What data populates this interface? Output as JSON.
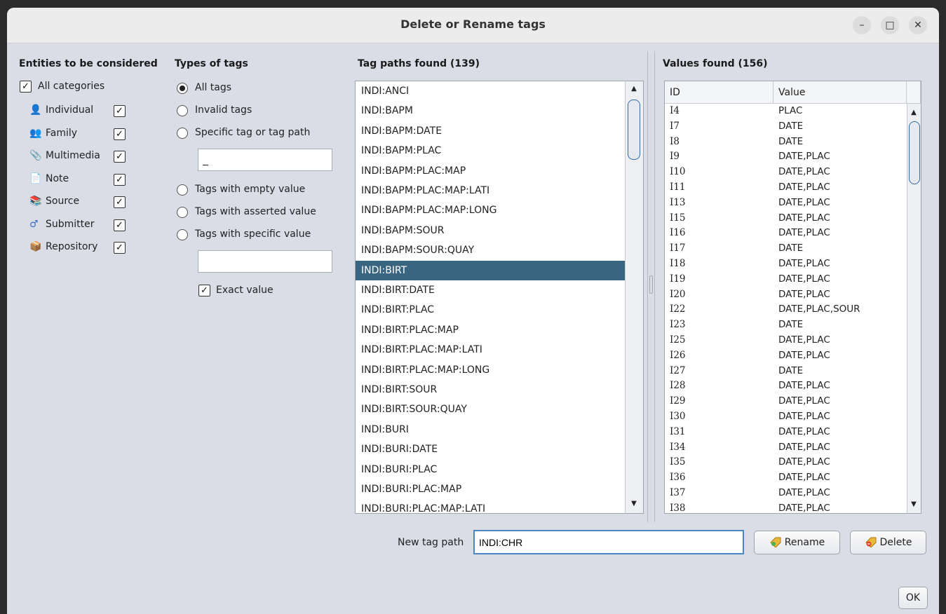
{
  "window": {
    "title": "Delete or Rename tags",
    "minimize_glyph": "–",
    "maximize_glyph": "□",
    "close_glyph": "✕"
  },
  "entities": {
    "heading": "Entities to be considered",
    "all_categories": {
      "label": "All categories",
      "checked": true
    },
    "items": [
      {
        "label": "Individual",
        "icon": "individual-icon",
        "glyph": "👤",
        "color": "#d9a33b",
        "checked": true
      },
      {
        "label": "Family",
        "icon": "family-icon",
        "glyph": "👥",
        "color": "#d0392b",
        "checked": true
      },
      {
        "label": "Multimedia",
        "icon": "multimedia-icon",
        "glyph": "📎",
        "color": "#5d7fb8",
        "checked": true
      },
      {
        "label": "Note",
        "icon": "note-icon",
        "glyph": "📄",
        "color": "#e6b23a",
        "checked": true
      },
      {
        "label": "Source",
        "icon": "source-icon",
        "glyph": "📚",
        "color": "#c9822e",
        "checked": true
      },
      {
        "label": "Submitter",
        "icon": "submitter-icon",
        "glyph": "♂",
        "color": "#3b6fc4",
        "checked": true
      },
      {
        "label": "Repository",
        "icon": "repository-icon",
        "glyph": "📦",
        "color": "#c98a3a",
        "checked": true
      }
    ]
  },
  "tag_types": {
    "heading": "Types of tags",
    "options": [
      {
        "label": "All tags",
        "selected": true
      },
      {
        "label": "Invalid tags",
        "selected": false
      },
      {
        "label": "Specific tag or tag path",
        "selected": false
      },
      {
        "label": "Tags with empty value",
        "selected": false
      },
      {
        "label": "Tags with asserted value",
        "selected": false
      },
      {
        "label": "Tags with specific value",
        "selected": false
      }
    ],
    "specific_tag_value": "_",
    "specific_value_value": "",
    "exact_value": {
      "label": "Exact value",
      "checked": true
    }
  },
  "tag_paths": {
    "heading": "Tag paths found (139)",
    "selected_index": 9,
    "items": [
      "INDI:ANCI",
      "INDI:BAPM",
      "INDI:BAPM:DATE",
      "INDI:BAPM:PLAC",
      "INDI:BAPM:PLAC:MAP",
      "INDI:BAPM:PLAC:MAP:LATI",
      "INDI:BAPM:PLAC:MAP:LONG",
      "INDI:BAPM:SOUR",
      "INDI:BAPM:SOUR:QUAY",
      "INDI:BIRT",
      "INDI:BIRT:DATE",
      "INDI:BIRT:PLAC",
      "INDI:BIRT:PLAC:MAP",
      "INDI:BIRT:PLAC:MAP:LATI",
      "INDI:BIRT:PLAC:MAP:LONG",
      "INDI:BIRT:SOUR",
      "INDI:BIRT:SOUR:QUAY",
      "INDI:BURI",
      "INDI:BURI:DATE",
      "INDI:BURI:PLAC",
      "INDI:BURI:PLAC:MAP",
      "INDI:BURI:PLAC:MAP:LATI"
    ]
  },
  "values": {
    "heading": "Values found (156)",
    "columns": [
      "ID",
      "Value"
    ],
    "rows": [
      [
        "I4",
        "PLAC"
      ],
      [
        "I7",
        "DATE"
      ],
      [
        "I8",
        "DATE"
      ],
      [
        "I9",
        "DATE,PLAC"
      ],
      [
        "I10",
        "DATE,PLAC"
      ],
      [
        "I11",
        "DATE,PLAC"
      ],
      [
        "I13",
        "DATE,PLAC"
      ],
      [
        "I15",
        "DATE,PLAC"
      ],
      [
        "I16",
        "DATE,PLAC"
      ],
      [
        "I17",
        "DATE"
      ],
      [
        "I18",
        "DATE,PLAC"
      ],
      [
        "I19",
        "DATE,PLAC"
      ],
      [
        "I20",
        "DATE,PLAC"
      ],
      [
        "I22",
        "DATE,PLAC,SOUR"
      ],
      [
        "I23",
        "DATE"
      ],
      [
        "I25",
        "DATE,PLAC"
      ],
      [
        "I26",
        "DATE,PLAC"
      ],
      [
        "I27",
        "DATE"
      ],
      [
        "I28",
        "DATE,PLAC"
      ],
      [
        "I29",
        "DATE,PLAC"
      ],
      [
        "I30",
        "DATE,PLAC"
      ],
      [
        "I31",
        "DATE,PLAC"
      ],
      [
        "I34",
        "DATE,PLAC"
      ],
      [
        "I35",
        "DATE,PLAC"
      ],
      [
        "I36",
        "DATE,PLAC"
      ],
      [
        "I37",
        "DATE,PLAC"
      ],
      [
        "I38",
        "DATE,PLAC"
      ]
    ]
  },
  "footer": {
    "new_tag_path_label": "New tag path",
    "new_tag_path_value": "INDI:CHR",
    "rename_label": "Rename",
    "delete_label": "Delete",
    "ok_label": "OK"
  },
  "colors": {
    "selection": "#3a6581",
    "window_bg": "#dadde6",
    "scroll_thumb_border": "#2e6aa8"
  }
}
